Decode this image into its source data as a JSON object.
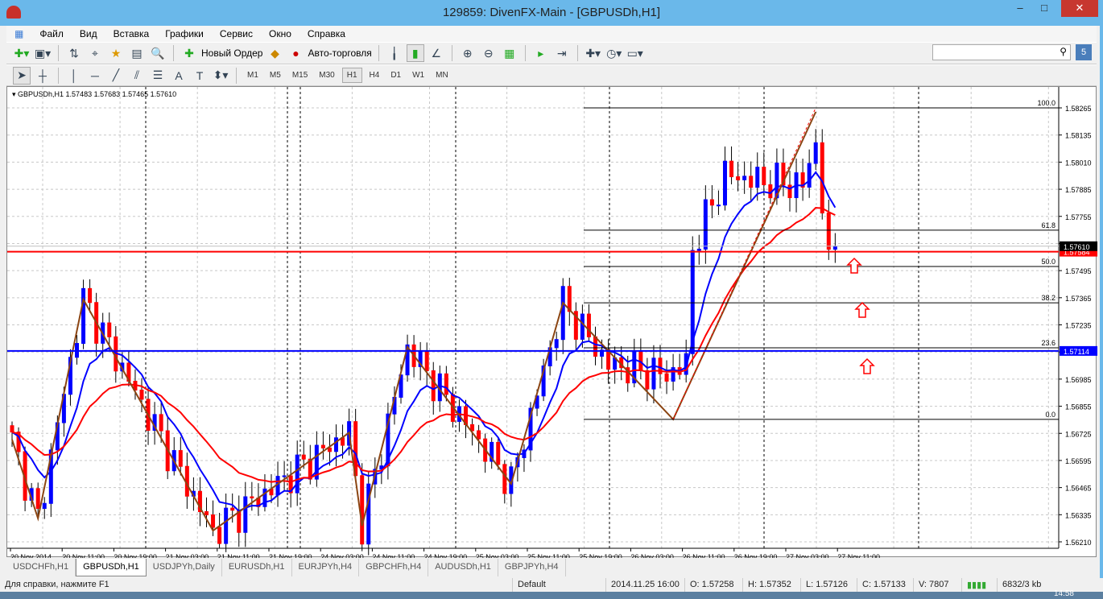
{
  "window": {
    "title": "129859: DivenFX-Main - [GBPUSDh,H1]",
    "min": "–",
    "max": "□",
    "close": "✕",
    "close_color": "#c7372f"
  },
  "menu": [
    "Файл",
    "Вид",
    "Вставка",
    "Графики",
    "Сервис",
    "Окно",
    "Справка"
  ],
  "toolbar": {
    "new_order": "Новый Ордер",
    "autotrading": "Авто-торговля",
    "search_placeholder": ""
  },
  "timeframes": [
    "M1",
    "M5",
    "M15",
    "M30",
    "H1",
    "H4",
    "D1",
    "W1",
    "MN"
  ],
  "active_timeframe": "H1",
  "chart_header": "GBPUSDh,H1  1.57483 1.57683 1.57465 1.57610",
  "chart_data": {
    "type": "candlestick",
    "symbol": "GBPUSDh",
    "timeframe": "H1",
    "ylim": [
      1.5621,
      1.583
    ],
    "price_ticks": [
      "1.58265",
      "1.58135",
      "1.58010",
      "1.57885",
      "1.57755",
      "1.57625",
      "1.57495",
      "1.57365",
      "1.57235",
      "1.57105",
      "1.56985",
      "1.56855",
      "1.56725",
      "1.56595",
      "1.56465",
      "1.56335",
      "1.56210"
    ],
    "time_labels": [
      "20 Nov 2014",
      "20 Nov 11:00",
      "20 Nov 19:00",
      "21 Nov 03:00",
      "21 Nov 11:00",
      "21 Nov 19:00",
      "24 Nov 03:00",
      "24 Nov 11:00",
      "24 Nov 19:00",
      "25 Nov 03:00",
      "25 Nov 11:00",
      "25 Nov 19:00",
      "26 Nov 03:00",
      "26 Nov 11:00",
      "26 Nov 19:00",
      "27 Nov 03:00",
      "27 Nov 11:00"
    ],
    "bars": 128,
    "price_path": [
      [
        0,
        1.5669
      ],
      [
        4,
        1.5632
      ],
      [
        11,
        1.5736
      ],
      [
        31,
        1.5626
      ],
      [
        52,
        1.5673
      ],
      [
        54,
        1.5629
      ],
      [
        61,
        1.5713
      ],
      [
        77,
        1.5649
      ],
      [
        85,
        1.5734
      ],
      [
        92,
        1.5705
      ],
      [
        101,
        1.57
      ],
      [
        104,
        1.5705
      ],
      [
        105,
        1.576
      ],
      [
        110,
        1.5795
      ],
      [
        115,
        1.5792
      ],
      [
        122,
        1.579
      ],
      [
        124,
        1.581
      ],
      [
        126,
        1.5752
      ],
      [
        127,
        1.5761
      ]
    ],
    "zigzag": [
      [
        0,
        1.56694
      ],
      [
        4,
        1.56321
      ],
      [
        11,
        1.57358
      ],
      [
        31,
        1.56263
      ],
      [
        52,
        1.56727
      ],
      [
        54,
        1.56286
      ],
      [
        61,
        1.57133
      ],
      [
        77,
        1.56485
      ],
      [
        85,
        1.57342
      ],
      [
        102,
        1.5679
      ],
      [
        124,
        1.58246
      ]
    ],
    "fibonacci": {
      "levels": [
        {
          "label": "100.0",
          "price": 1.58265
        },
        {
          "label": "61.8",
          "price": 1.57686
        },
        {
          "label": "50.0",
          "price": 1.57514
        },
        {
          "label": "38.2",
          "price": 1.57342
        },
        {
          "label": "23.6",
          "price": 1.57129
        },
        {
          "label": "0.0",
          "price": 1.5679
        }
      ]
    },
    "hlines": [
      {
        "label": "1.57584",
        "price": 1.57584,
        "color": "#ff0000"
      },
      {
        "label": "1.57114",
        "price": 1.57114,
        "color": "#0000ff"
      },
      {
        "label": "1.57610",
        "price": 1.5761,
        "color": "#000000"
      }
    ],
    "ma_fast_color": "#0000ff",
    "ma_slow_color": "#ff0000",
    "bull_color": "#0000ff",
    "bear_color": "#ff0000",
    "zigzag_color": "#8b4513"
  },
  "tabs": [
    "USDCHFh,H1",
    "GBPUSDh,H1",
    "USDJPYh,Daily",
    "EURUSDh,H1",
    "EURJPYh,H4",
    "GBPCHFh,H4",
    "AUDUSDh,H1",
    "GBPJPYh,H4"
  ],
  "active_tab": 1,
  "status": {
    "help": "Для справки, нажмите F1",
    "profile": "Default",
    "datetime": "2014.11.25 16:00",
    "open": "O: 1.57258",
    "high": "H: 1.57352",
    "low": "L: 1.57126",
    "close": "C: 1.57133",
    "volume": "V: 7807",
    "traffic": "6832/3 kb",
    "clock": "14:58"
  }
}
